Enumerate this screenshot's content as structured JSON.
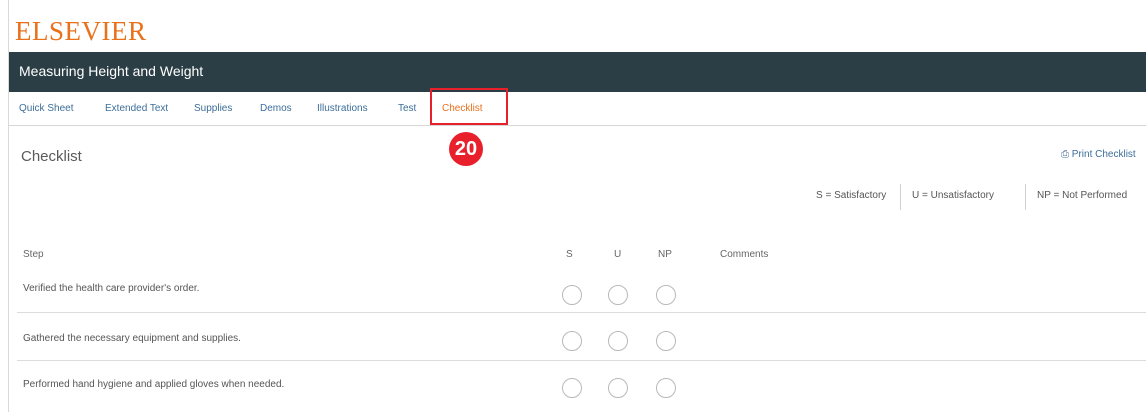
{
  "brand": {
    "logo": "ELSEVIER",
    "accent": "#e9711c",
    "header_bg": "#2b3e45"
  },
  "header": {
    "title": "Measuring Height and Weight"
  },
  "tabs": [
    {
      "label": "Quick Sheet"
    },
    {
      "label": "Extended Text"
    },
    {
      "label": "Supplies"
    },
    {
      "label": "Demos"
    },
    {
      "label": "Illustrations"
    },
    {
      "label": "Test"
    },
    {
      "label": "Checklist",
      "active": true
    }
  ],
  "annotation": {
    "callout_number": "20",
    "color": "#e8202b"
  },
  "main": {
    "section_title": "Checklist",
    "print_link": "Print Checklist",
    "legend": [
      {
        "label": "S = Satisfactory"
      },
      {
        "label": "U = Unsatisfactory"
      },
      {
        "label": "NP = Not Performed"
      }
    ],
    "columns": {
      "step": "Step",
      "s": "S",
      "u": "U",
      "np": "NP",
      "comments": "Comments"
    },
    "rows": [
      {
        "step": "Verified the health care provider's order."
      },
      {
        "step": "Gathered the necessary equipment and supplies."
      },
      {
        "step": "Performed hand hygiene and applied gloves when needed."
      }
    ]
  }
}
